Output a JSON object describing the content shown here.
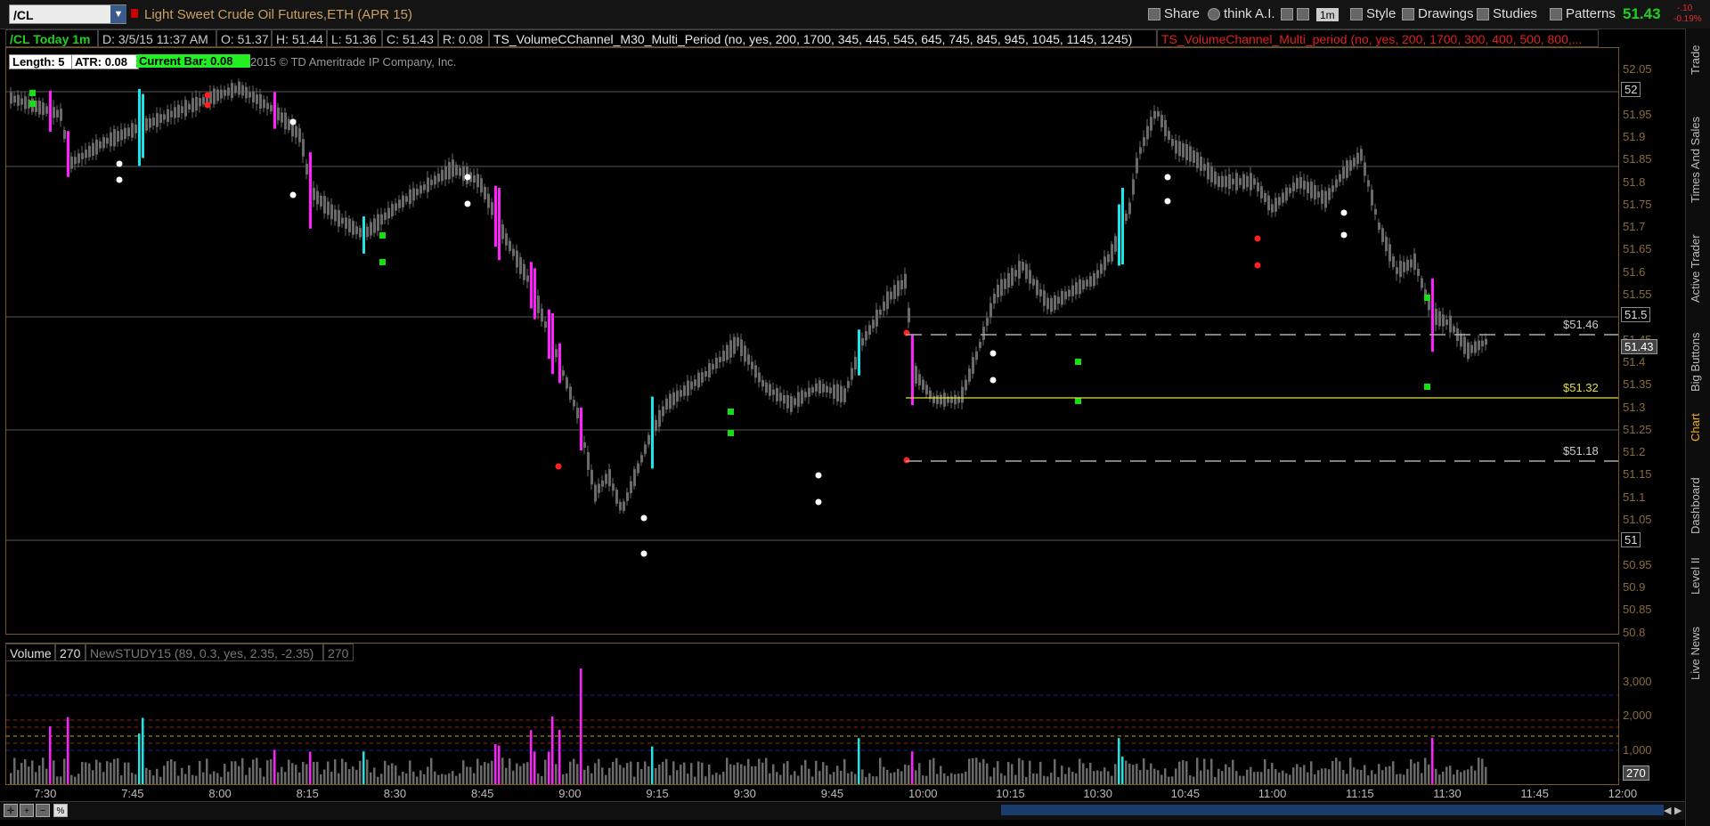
{
  "toolbar": {
    "symbol": "/CL",
    "description": "Light Sweet Crude Oil Futures,ETH (APR 15)",
    "buttons": {
      "share": "Share",
      "think": "think A.I.",
      "interval": "1m",
      "style": "Style",
      "drawings": "Drawings",
      "studies": "Studies",
      "patterns": "Patterns"
    },
    "last_price": "51.43",
    "change": "-.10",
    "change_pct": "-0.19%"
  },
  "info": {
    "title": "/CL Today 1m",
    "date": "D: 3/5/15 11:37 AM",
    "open": "O: 51.37",
    "high": "H: 51.44",
    "low": "L: 51.36",
    "close": "C: 51.43",
    "range": "R: 0.08",
    "study1": "TS_VolumeCChannel_M30_Multi_Period (no, yes, 200, 1700, 345, 445, 545, 645, 745, 845, 945, 1045, 1145, 1245)",
    "study2": "TS_VolumeChannel_Multi_period (no, yes, 200, 1700, 300, 400, 500, 800,...",
    "length": "Length: 5",
    "atr": "ATR: 0.08",
    "current_bar": "Current Bar: 0.08",
    "copyright": "2015 © TD Ameritrade IP Company, Inc."
  },
  "price_axis": {
    "ticks": [
      "52.05",
      "52",
      "51.95",
      "51.9",
      "51.85",
      "51.8",
      "51.75",
      "51.7",
      "51.65",
      "51.6",
      "51.55",
      "51.5",
      "51.45",
      "51.4",
      "51.35",
      "51.3",
      "51.25",
      "51.2",
      "51.15",
      "51.1",
      "51.05",
      "51",
      "50.95",
      "50.9",
      "50.85",
      "50.8"
    ],
    "current_tag": "51.43",
    "label_52": "52",
    "label_515": "51.5",
    "label_51": "51"
  },
  "levels": {
    "upper": "$51.46",
    "middle": "$51.32",
    "lower": "$51.18"
  },
  "volume_pane": {
    "label": "Volume",
    "value": "270",
    "study": "NewSTUDY15 (89, 0.3, yes, 2.35, -2.35)",
    "study_value": "270",
    "ticks": [
      "3,000",
      "2,000",
      "1,000"
    ],
    "current_tag": "270"
  },
  "time_axis": [
    "7:30",
    "7:45",
    "8:00",
    "8:15",
    "8:30",
    "8:45",
    "9:00",
    "9:15",
    "9:30",
    "9:45",
    "10:00",
    "10:15",
    "10:30",
    "10:45",
    "11:00",
    "11:15",
    "11:30",
    "11:45",
    "12:00"
  ],
  "side_tabs": [
    "Trade",
    "Times And Sales",
    "Active Trader",
    "Big Buttons",
    "Chart",
    "Dashboard",
    "Level II",
    "Live News"
  ],
  "colors": {
    "up": "#6a6a6a",
    "magenta": "#ff1fff",
    "cyan": "#19e6e6",
    "green": "#14e014",
    "red": "#ff2020",
    "level_yellow": "#e0e040"
  }
}
